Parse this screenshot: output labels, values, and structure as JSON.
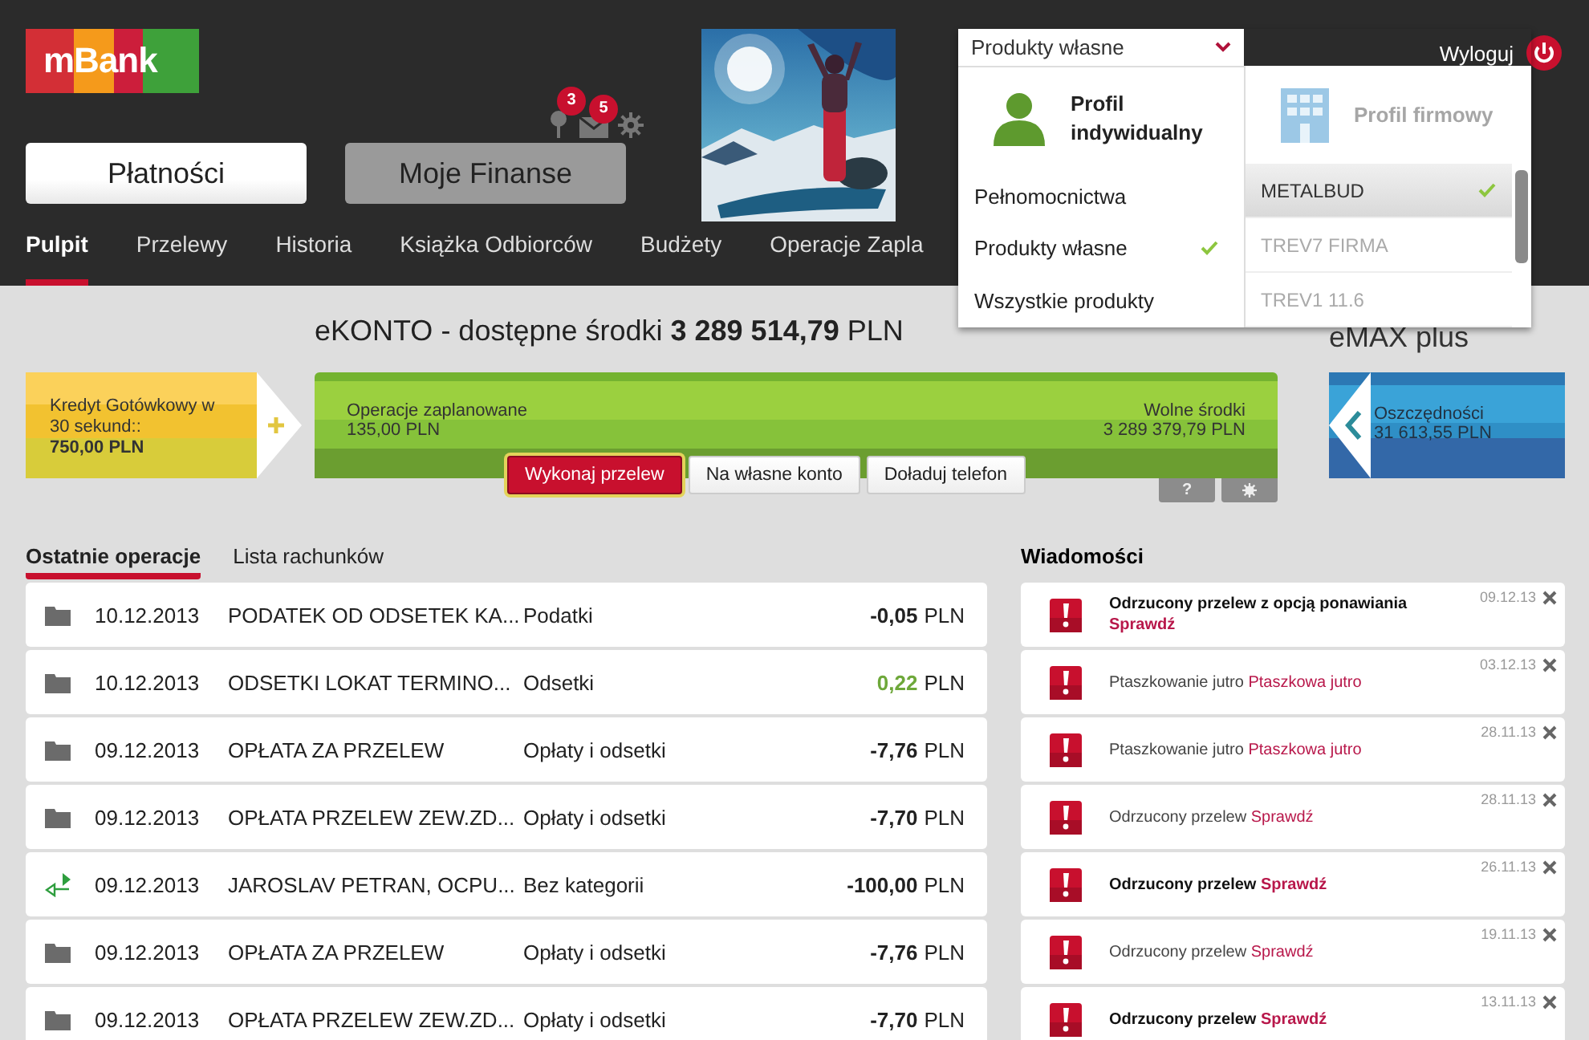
{
  "header": {
    "logo": "mBank",
    "notifications": [
      {
        "kind": "pin",
        "count": "3"
      },
      {
        "kind": "mail",
        "count": "5"
      }
    ],
    "main_tabs": [
      {
        "label": "Płatności",
        "selected": true
      },
      {
        "label": "Moje Finanse",
        "selected": false
      }
    ],
    "logout": "Wyloguj",
    "nav": [
      {
        "label": "Pulpit",
        "selected": true
      },
      {
        "label": "Przelewy",
        "selected": false
      },
      {
        "label": "Historia",
        "selected": false
      },
      {
        "label": "Książka Odbiorców",
        "selected": false
      },
      {
        "label": "Budżety",
        "selected": false
      },
      {
        "label": "Operacje Zapla",
        "selected": false
      }
    ]
  },
  "profile_menu": {
    "select": {
      "value": "Produkty własne"
    },
    "individual": {
      "title": "Profil indywidualny",
      "selected": true,
      "items": [
        {
          "label": "Pełnomocnictwa",
          "checked": false
        },
        {
          "label": "Produkty własne",
          "checked": true
        },
        {
          "label": "Wszystkie produkty",
          "checked": false
        }
      ]
    },
    "business": {
      "title": "Profil firmowy",
      "selected": false,
      "items": [
        {
          "label": "METALBUD",
          "selected": true
        },
        {
          "label": "TREV7 FIRMA",
          "selected": false
        },
        {
          "label": "TREV1 11.6",
          "selected": false
        }
      ]
    }
  },
  "account": {
    "title": "eKONTO - dostępne środki **3 289 514,79** PLN",
    "loan": {
      "label": "Kredyt Gotówkowy w 30 sekund::",
      "amount": "750,00 PLN"
    },
    "planned": {
      "label": "Operacje zaplanowane",
      "amount": "135,00 PLN"
    },
    "free": {
      "label": "Wolne środki",
      "amount": "3 289 379,79 PLN"
    },
    "savings": {
      "name": "eMAX plus",
      "label": "Oszczędności",
      "amount": "31 613,55 PLN"
    },
    "actions": [
      {
        "label": "Wykonaj przelew",
        "kind": "primary"
      },
      {
        "label": "Na własne konto",
        "kind": "secondary"
      },
      {
        "label": "Doładuj telefon",
        "kind": "secondary"
      }
    ],
    "help": "?"
  },
  "operations": {
    "tabs": [
      {
        "label": "Ostatnie operacje",
        "selected": true
      },
      {
        "label": "Lista rachunków",
        "selected": false
      }
    ],
    "rows": [
      {
        "kind": "folder",
        "date": "10.12.2013",
        "title": "PODATEK OD ODSETEK KA...",
        "category": "Podatki",
        "amount": "-0,05",
        "currency": "PLN",
        "positive": false
      },
      {
        "kind": "folder",
        "date": "10.12.2013",
        "title": "ODSETKI LOKAT TERMINO...",
        "category": "Odsetki",
        "amount": "0,22",
        "currency": "PLN",
        "positive": true
      },
      {
        "kind": "folder",
        "date": "09.12.2013",
        "title": "OPŁATA ZA PRZELEW",
        "category": "Opłaty i odsetki",
        "amount": "-7,76",
        "currency": "PLN",
        "positive": false
      },
      {
        "kind": "folder",
        "date": "09.12.2013",
        "title": "OPŁATA PRZELEW ZEW.ZD...",
        "category": "Opłaty i odsetki",
        "amount": "-7,70",
        "currency": "PLN",
        "positive": false
      },
      {
        "kind": "transfer",
        "date": "09.12.2013",
        "title": "JAROSLAV PETRAN, OCPU...",
        "category": "Bez kategorii",
        "amount": "-100,00",
        "currency": "PLN",
        "positive": false
      },
      {
        "kind": "folder",
        "date": "09.12.2013",
        "title": "OPŁATA ZA PRZELEW",
        "category": "Opłaty i odsetki",
        "amount": "-7,76",
        "currency": "PLN",
        "positive": false
      },
      {
        "kind": "folder",
        "date": "09.12.2013",
        "title": "OPŁATA PRZELEW ZEW.ZD...",
        "category": "Opłaty i odsetki",
        "amount": "-7,70",
        "currency": "PLN",
        "positive": false
      }
    ]
  },
  "messages": {
    "title": "Wiadomości",
    "items": [
      {
        "text": "Odrzucony przelew z opcją ponawiania",
        "link": "Sprawdź",
        "date": "09.12.13",
        "unread": true
      },
      {
        "text": "Ptaszkowanie jutro",
        "link": "Ptaszkowa jutro",
        "date": "03.12.13",
        "unread": false
      },
      {
        "text": "Ptaszkowanie jutro",
        "link": "Ptaszkowa jutro",
        "date": "28.11.13",
        "unread": false
      },
      {
        "text": "Odrzucony przelew",
        "link": "Sprawdź",
        "date": "28.11.13",
        "unread": false
      },
      {
        "text": "Odrzucony przelew",
        "link": "Sprawdź",
        "date": "26.11.13",
        "unread": true
      },
      {
        "text": "Odrzucony przelew",
        "link": "Sprawdź",
        "date": "19.11.13",
        "unread": false
      },
      {
        "text": "Odrzucony przelew",
        "link": "Sprawdź",
        "date": "13.11.13",
        "unread": true
      }
    ]
  }
}
